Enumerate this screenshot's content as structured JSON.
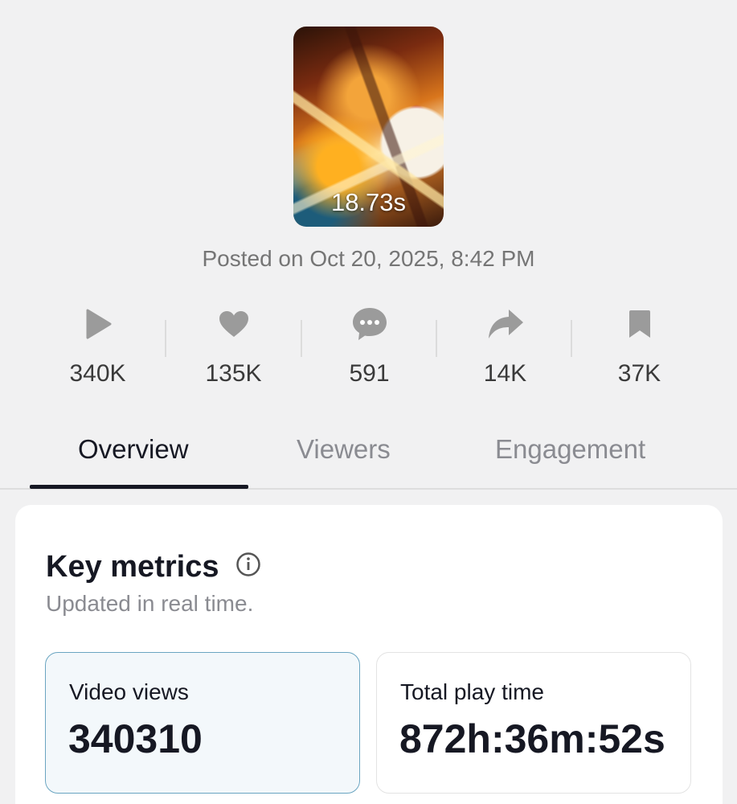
{
  "video": {
    "duration": "18.73s",
    "posted": "Posted on Oct 20, 2025, 8:42 PM"
  },
  "stats": [
    {
      "name": "views",
      "icon": "play-icon",
      "value": "340K"
    },
    {
      "name": "likes",
      "icon": "heart-icon",
      "value": "135K"
    },
    {
      "name": "comments",
      "icon": "comment-icon",
      "value": "591"
    },
    {
      "name": "shares",
      "icon": "share-icon",
      "value": "14K"
    },
    {
      "name": "saves",
      "icon": "bookmark-icon",
      "value": "37K"
    }
  ],
  "tabs": [
    {
      "label": "Overview",
      "active": true
    },
    {
      "label": "Viewers",
      "active": false
    },
    {
      "label": "Engagement",
      "active": false
    }
  ],
  "key_metrics": {
    "title": "Key metrics",
    "subtitle": "Updated in real time.",
    "info_icon": "info-icon",
    "cards": [
      {
        "label": "Video views",
        "value": "340310",
        "selected": true
      },
      {
        "label": "Total play time",
        "value": "872h:36m:52s",
        "selected": false
      }
    ]
  },
  "colors": {
    "background": "#f1f1f2",
    "text_primary": "#161823",
    "text_secondary": "#8a8b91",
    "icon_gray": "#9b9b9b",
    "selected_card_bg": "#f3f8fb",
    "selected_card_border": "#6aa5c1"
  }
}
